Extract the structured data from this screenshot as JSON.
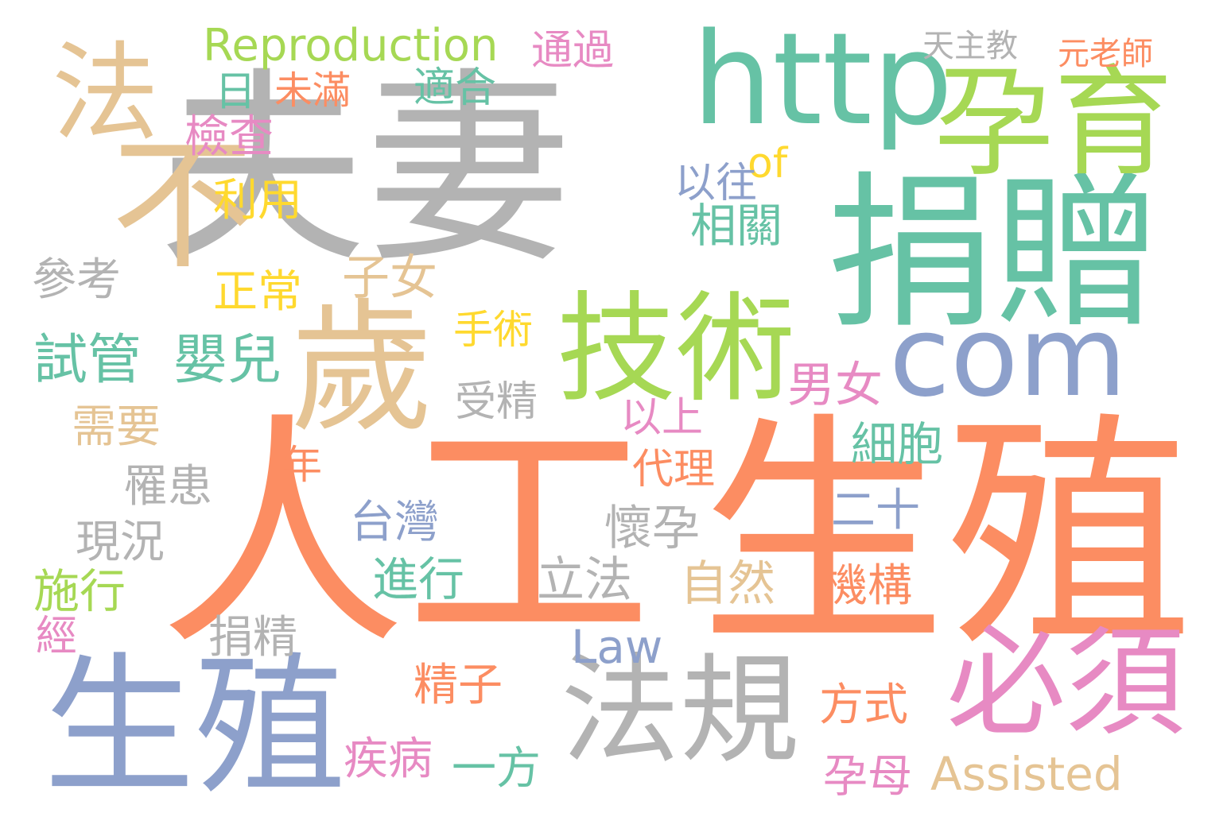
{
  "palette": {
    "orange": "#fc8d62",
    "blue": "#8da0cb",
    "pink": "#e78ac3",
    "green": "#a6d854",
    "yellow": "#ffd92f",
    "tan": "#e5c494",
    "gray": "#b3b3b3",
    "teal": "#66c2a5"
  },
  "words": [
    {
      "text": "人工",
      "color": "#fc8d62"
    },
    {
      "text": "生殖",
      "color": "#fc8d62"
    },
    {
      "text": "夫妻",
      "color": "#b3b3b3"
    },
    {
      "text": "捐贈",
      "color": "#66c2a5"
    },
    {
      "text": "孕育",
      "color": "#a6d854"
    },
    {
      "text": "http",
      "color": "#66c2a5"
    },
    {
      "text": "技術",
      "color": "#a6d854"
    },
    {
      "text": "生殖",
      "color": "#8da0cb"
    },
    {
      "text": "歲",
      "color": "#e5c494"
    },
    {
      "text": "不",
      "color": "#e5c494"
    },
    {
      "text": "法",
      "color": "#e5c494"
    },
    {
      "text": "com",
      "color": "#8da0cb"
    },
    {
      "text": "法規",
      "color": "#b3b3b3"
    },
    {
      "text": "必須",
      "color": "#e78ac3"
    },
    {
      "text": "Reproduction",
      "color": "#a6d854"
    },
    {
      "text": "Assisted",
      "color": "#e5c494"
    },
    {
      "text": "Law",
      "color": "#8da0cb"
    },
    {
      "text": "of",
      "color": "#ffd92f"
    },
    {
      "text": "嬰兒",
      "color": "#66c2a5"
    },
    {
      "text": "試管",
      "color": "#66c2a5"
    },
    {
      "text": "檢查",
      "color": "#e78ac3"
    },
    {
      "text": "適合",
      "color": "#66c2a5"
    },
    {
      "text": "通過",
      "color": "#e78ac3"
    },
    {
      "text": "未滿",
      "color": "#fc8d62"
    },
    {
      "text": "利用",
      "color": "#ffd92f"
    },
    {
      "text": "參考",
      "color": "#b3b3b3"
    },
    {
      "text": "子女",
      "color": "#e5c494"
    },
    {
      "text": "相關",
      "color": "#66c2a5"
    },
    {
      "text": "以往",
      "color": "#8da0cb"
    },
    {
      "text": "正常",
      "color": "#ffd92f"
    },
    {
      "text": "手術",
      "color": "#ffd92f"
    },
    {
      "text": "男女",
      "color": "#e78ac3"
    },
    {
      "text": "受精",
      "color": "#b3b3b3"
    },
    {
      "text": "以上",
      "color": "#e78ac3"
    },
    {
      "text": "細胞",
      "color": "#66c2a5"
    },
    {
      "text": "需要",
      "color": "#e5c494"
    },
    {
      "text": "罹患",
      "color": "#b3b3b3"
    },
    {
      "text": "代理",
      "color": "#fc8d62"
    },
    {
      "text": "年",
      "color": "#fc8d62"
    },
    {
      "text": "台灣",
      "color": "#8da0cb"
    },
    {
      "text": "懷孕",
      "color": "#b3b3b3"
    },
    {
      "text": "現況",
      "color": "#b3b3b3"
    },
    {
      "text": "二十",
      "color": "#8da0cb"
    },
    {
      "text": "施行",
      "color": "#a6d854"
    },
    {
      "text": "進行",
      "color": "#66c2a5"
    },
    {
      "text": "立法",
      "color": "#b3b3b3"
    },
    {
      "text": "自然",
      "color": "#e5c494"
    },
    {
      "text": "機構",
      "color": "#fc8d62"
    },
    {
      "text": "捐精",
      "color": "#b3b3b3"
    },
    {
      "text": "經",
      "color": "#e78ac3"
    },
    {
      "text": "精子",
      "color": "#fc8d62"
    },
    {
      "text": "方式",
      "color": "#fc8d62"
    },
    {
      "text": "疾病",
      "color": "#e78ac3"
    },
    {
      "text": "一方",
      "color": "#66c2a5"
    },
    {
      "text": "孕母",
      "color": "#e78ac3"
    },
    {
      "text": "元老師",
      "color": "#fc8d62"
    },
    {
      "text": "天主教",
      "color": "#b3b3b3"
    },
    {
      "text": "日",
      "color": "#66c2a5"
    },
    {
      "text": "Reproduction",
      "color": "#a6d854"
    }
  ]
}
